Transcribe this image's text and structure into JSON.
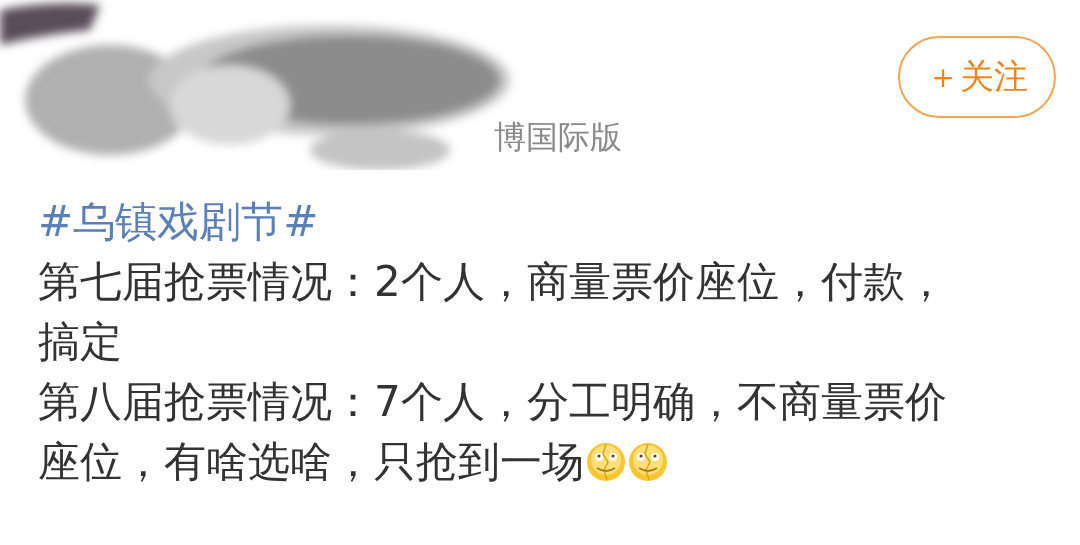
{
  "follow_button": {
    "label": "＋关注"
  },
  "source": "博国际版",
  "post": {
    "topic": "#乌镇戏剧节#",
    "paragraphs": [
      "第七届抢票情况：2个人，商量票价座位，付款，搞定",
      "第八届抢票情况：7个人，分工明确，不商量票价座位，有啥选啥，只抢到一场"
    ],
    "emojis": [
      {
        "kind": "cracked-smile"
      },
      {
        "kind": "cracked-smile"
      }
    ]
  }
}
